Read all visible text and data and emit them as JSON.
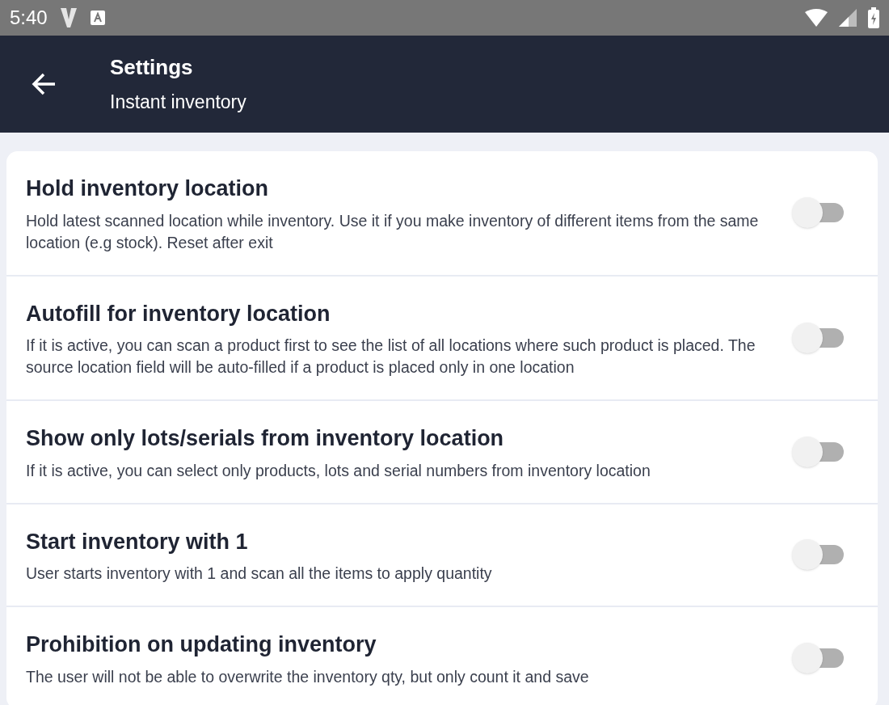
{
  "status_bar": {
    "time": "5:40"
  },
  "app_bar": {
    "title": "Settings",
    "subtitle": "Instant inventory"
  },
  "settings": [
    {
      "title": "Hold inventory location",
      "description": "Hold latest scanned location while inventory. Use it if you make inventory of different items from the same location (e.g stock). Reset after exit",
      "on": false
    },
    {
      "title": "Autofill for inventory location",
      "description": "If it is active, you can scan a product first to see the list of all locations where such product is placed. The source location field will be auto-filled if a product is placed only in one location",
      "on": false
    },
    {
      "title": "Show only lots/serials from inventory location",
      "description": "If it is active, you can select only products, lots and serial numbers from inventory location",
      "on": false
    },
    {
      "title": "Start inventory with 1",
      "description": "User starts inventory with 1 and scan all the items to apply quantity",
      "on": false
    },
    {
      "title": "Prohibition on updating inventory",
      "description": "The user will not be able to overwrite the inventory qty, but only count it and save",
      "on": false
    }
  ]
}
